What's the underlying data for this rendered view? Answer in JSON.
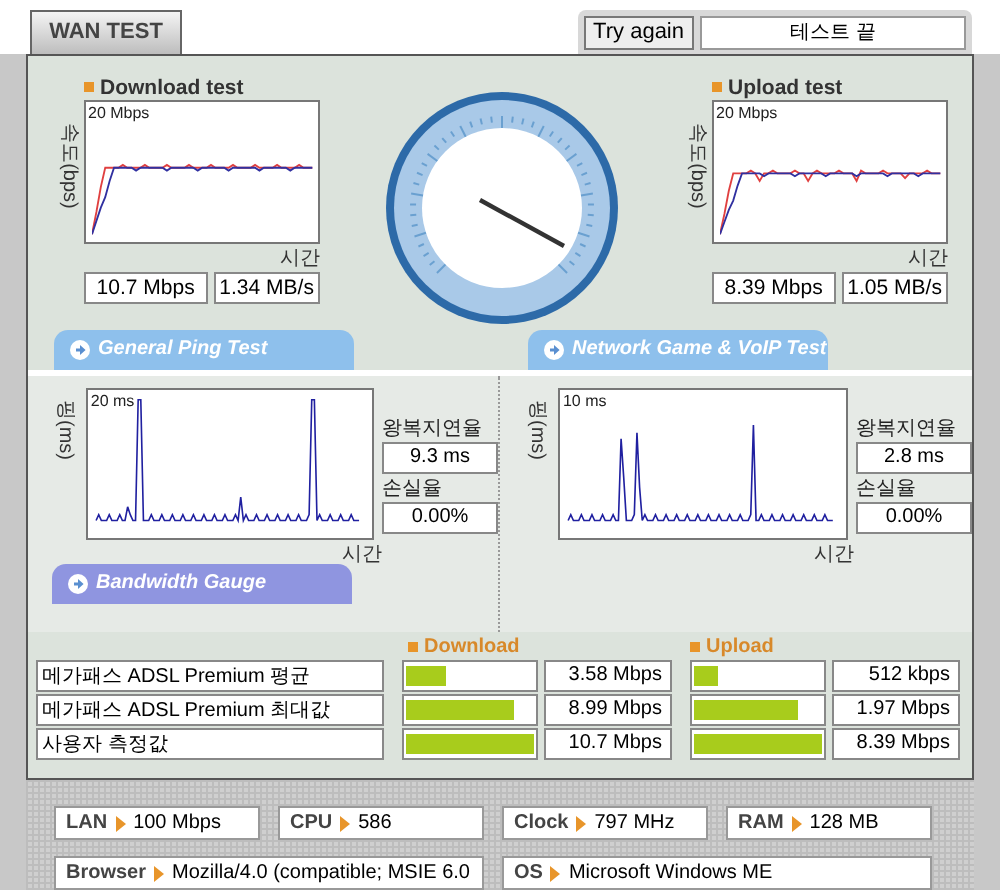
{
  "tab": {
    "label": "WAN TEST",
    "selected": true
  },
  "try_again": "Try again",
  "status": "테스트 끝",
  "speed": [
    {
      "kind": "download",
      "title": "Download test",
      "axis": "속도(bps)",
      "scale": "20 Mbps",
      "time": "시간",
      "bits": "10.7 Mbps",
      "bytes": "1.34 MB/s"
    },
    {
      "kind": "upload",
      "title": "Upload test",
      "axis": "속도(bps)",
      "scale": "20 Mbps",
      "time": "시간",
      "bits": "8.39 Mbps",
      "bytes": "1.05 MB/s"
    }
  ],
  "sections": [
    {
      "label": "General Ping Test"
    },
    {
      "label": "Network Game & VoIP Test"
    }
  ],
  "ping": [
    {
      "kind": "general",
      "axis": "핑(ms)",
      "scale": "20 ms",
      "time": "시간",
      "latency_label": "왕복지연율",
      "latency": "9.3 ms",
      "loss_label": "손실율",
      "loss": "0.00%"
    },
    {
      "kind": "game",
      "axis": "핑(ms)",
      "scale": "10 ms",
      "time": "시간",
      "latency_label": "왕복지연율",
      "latency": "2.8 ms",
      "loss_label": "손실율",
      "loss": "0.00%"
    }
  ],
  "bandwidth": {
    "title": "Bandwidth Gauge",
    "download_label": "Download",
    "upload_label": "Upload",
    "rows": [
      {
        "name": "메가패스 ADSL Premium 평균",
        "download": {
          "value": "3.58 Mbps",
          "level": 0.32
        },
        "upload": {
          "value": "512 kbps",
          "level": 0.19
        }
      },
      {
        "name": "메가패스 ADSL Premium 최대값",
        "download": {
          "value": "8.99 Mbps",
          "level": 0.84
        },
        "upload": {
          "value": "1.97 Mbps",
          "level": 0.81
        }
      },
      {
        "name": "사용자 측정값",
        "download": {
          "value": "10.7 Mbps",
          "level": 1.0
        },
        "upload": {
          "value": "8.39 Mbps",
          "level": 1.0
        }
      }
    ]
  },
  "system": [
    {
      "label": "LAN",
      "value": "100 Mbps"
    },
    {
      "label": "CPU",
      "value": "586"
    },
    {
      "label": "Clock",
      "value": "797 MHz"
    },
    {
      "label": "RAM",
      "value": "128 MB"
    },
    {
      "label": "Browser",
      "value": "Mozilla/4.0 (compatible; MSIE 6.0"
    },
    {
      "label": "OS",
      "value": "Microsoft Windows ME"
    }
  ]
}
